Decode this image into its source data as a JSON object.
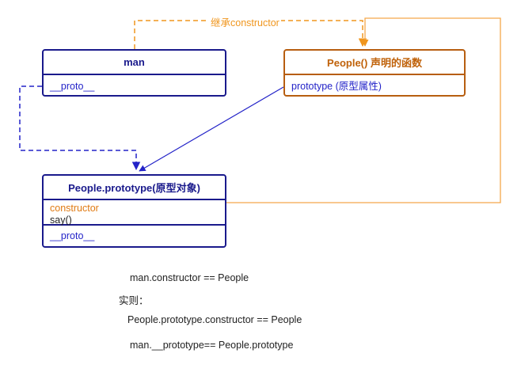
{
  "nodes": {
    "man": {
      "title": "man",
      "proto": "__proto__"
    },
    "people_fn": {
      "title": "People() 声明的函数",
      "prototype": "prototype (原型属性)"
    },
    "people_proto": {
      "title": "People.prototype(原型对象)",
      "constructor": "constructor",
      "say": "say()",
      "proto": "__proto__"
    }
  },
  "edges": {
    "inherit_label": "继承constructor"
  },
  "notes": {
    "line1": "man.constructor == People",
    "line2": "实则：",
    "line3": "People.prototype.constructor == People",
    "line4": "man.__prototype== People.prototype"
  },
  "colors": {
    "navy": "#1a1a8c",
    "blue": "#2323c8",
    "orange": "#f0961e",
    "brown": "#b75e10"
  }
}
